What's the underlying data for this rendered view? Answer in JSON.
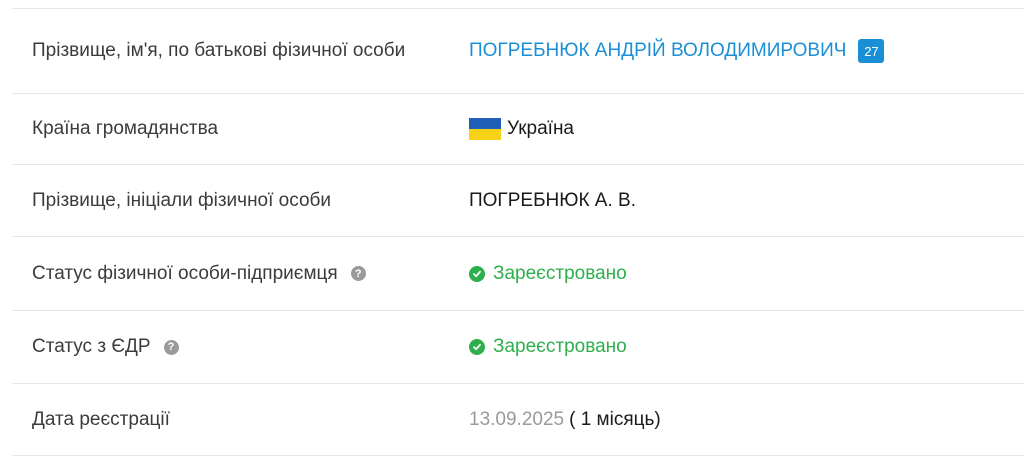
{
  "rows": [
    {
      "label": "Прізвище, ім'я, по батькові фізичної особи",
      "value": "ПОГРЕБНЮК АНДРІЙ ВОЛОДИМИРОВИЧ",
      "badge": "27"
    },
    {
      "label": "Країна громадянства",
      "value": "Україна",
      "icon": "ukraine-flag-icon"
    },
    {
      "label": "Прізвище, ініціали фізичної особи",
      "value": "ПОГРЕБНЮК А. В."
    },
    {
      "label": "Статус фізичної особи-підприємця",
      "help": "?",
      "value": "Зареєстровано",
      "icon": "check-circle-icon"
    },
    {
      "label": "Статус з ЄДР",
      "help": "?",
      "value": "Зареєстровано",
      "icon": "check-circle-icon"
    },
    {
      "label": "Дата реєстрації",
      "date": "13.09.2025",
      "duration": "( 1 місяць)"
    }
  ],
  "colors": {
    "link": "#1a8fd6",
    "status_ok": "#2db04c",
    "muted": "#9a9a9a",
    "divider": "#e6e6e6"
  }
}
